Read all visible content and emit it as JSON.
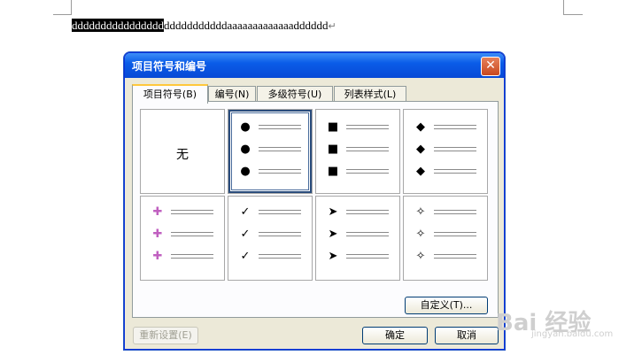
{
  "document": {
    "selected_text": "dddddddddddddddd",
    "rest_text": "dddddddddddaaaaaaaaaaaaadddddd",
    "paragraph_mark": "↵"
  },
  "dialog": {
    "title": "项目符号和编号",
    "close_label": "✕",
    "tabs": [
      {
        "label": "项目符号(B)"
      },
      {
        "label": "编号(N)"
      },
      {
        "label": "多级符号(U)"
      },
      {
        "label": "列表样式(L)"
      }
    ],
    "active_tab": "项目符号(B)",
    "bullet_options": [
      {
        "label": "无"
      },
      {
        "bullet": "●",
        "color": "#000000"
      },
      {
        "bullet": "■",
        "color": "#000000"
      },
      {
        "bullet": "◆",
        "color": "#000000"
      },
      {
        "bullet": "✚",
        "color": "#c060c0"
      },
      {
        "bullet": "✓",
        "color": "#000000"
      },
      {
        "bullet": "➤",
        "color": "#000000"
      },
      {
        "bullet": "✧",
        "color": "#000000"
      }
    ],
    "selected_index": 1,
    "customize_label": "自定义(T)...",
    "reset_label": "重新设置(E)",
    "ok_label": "确定",
    "cancel_label": "取消"
  },
  "watermark": {
    "brand": "Bai 经验",
    "url": "jingyan.baidu.com"
  }
}
